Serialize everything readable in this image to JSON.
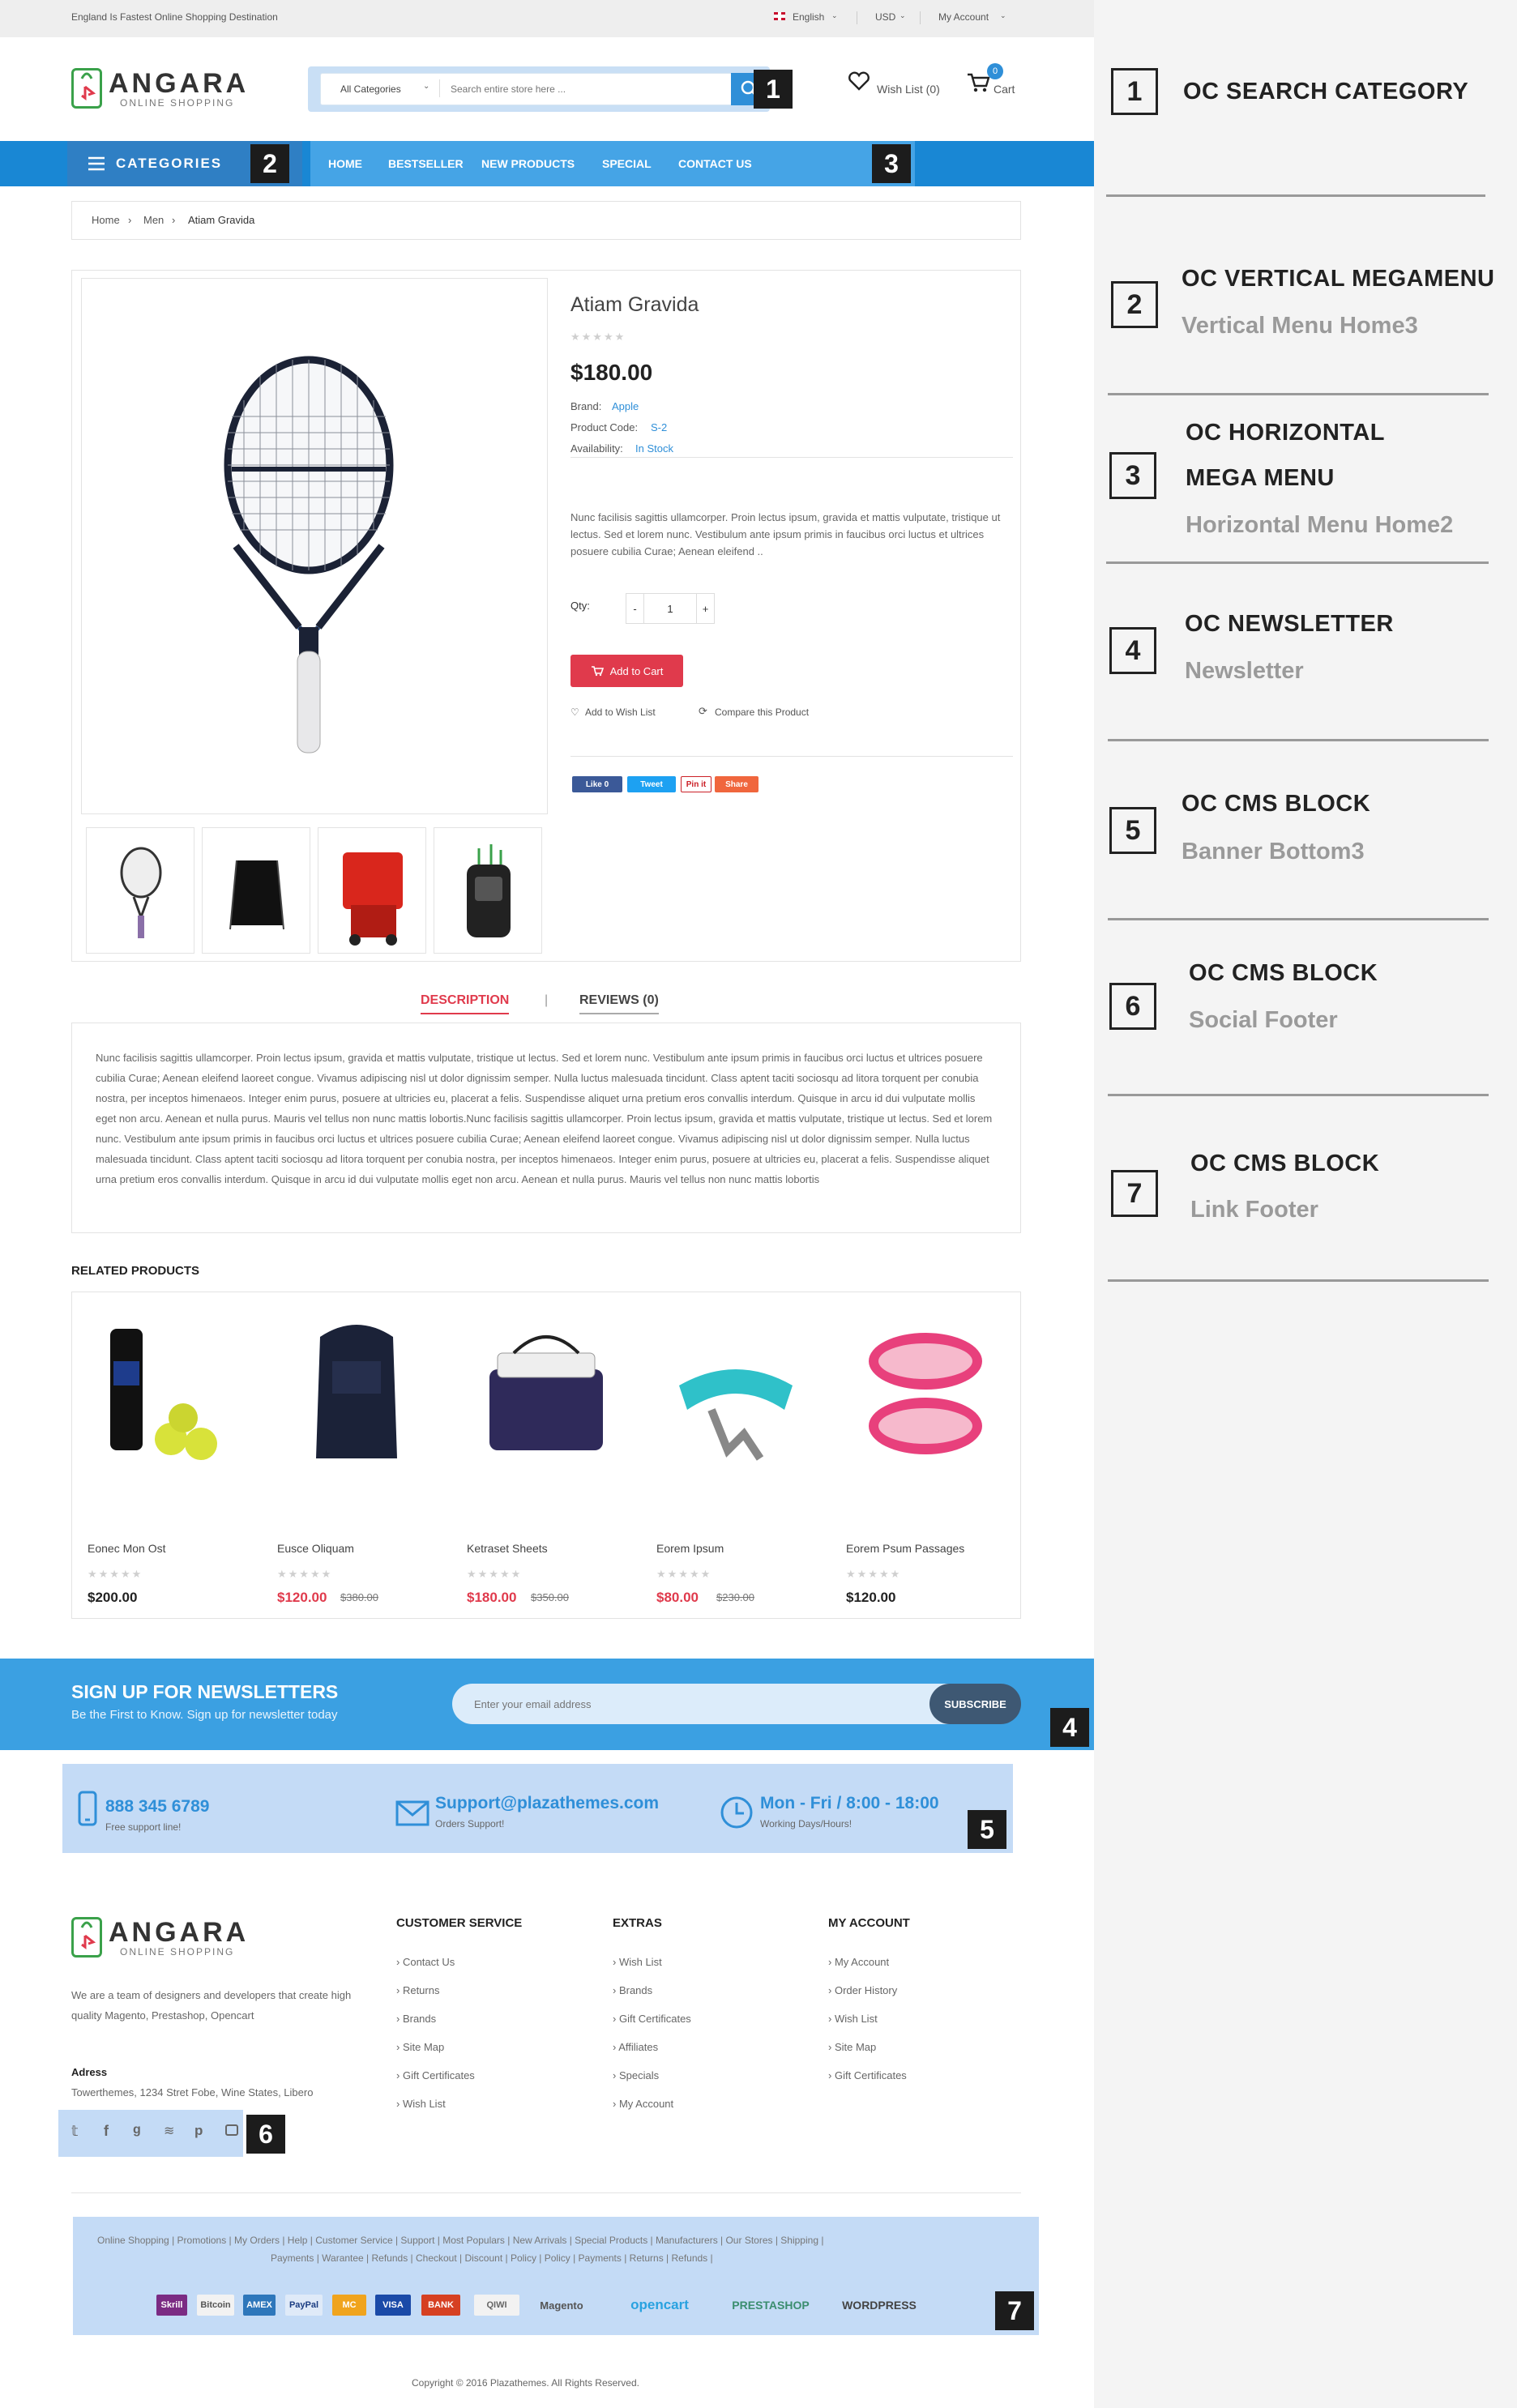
{
  "topbar": {
    "tagline": "England Is Fastest Online Shopping Destination",
    "language": "English",
    "currency": "USD",
    "account": "My Account"
  },
  "header": {
    "logo_title": "ANGARA",
    "logo_sub": "ONLINE SHOPPING",
    "search_category": "All Categories",
    "search_placeholder": "Search entire store here ...",
    "wishlist": "Wish List (0)",
    "cart_label": "Cart",
    "cart_count": "0"
  },
  "nav": {
    "categories": "CATEGORIES",
    "items": [
      "HOME",
      "BESTSELLER",
      "NEW PRODUCTS",
      "SPECIAL",
      "CONTACT US"
    ]
  },
  "breadcrumb": [
    "Home",
    "Men",
    "Atiam Gravida"
  ],
  "product": {
    "title": "Atiam Gravida",
    "price": "$180.00",
    "brand_label": "Brand:",
    "brand": "Apple",
    "code_label": "Product Code:",
    "code": "S-2",
    "availability_label": "Availability:",
    "availability": "In Stock",
    "short_desc": "Nunc facilisis sagittis ullamcorper. Proin lectus ipsum, gravida et mattis vulputate, tristique ut lectus. Sed et lorem nunc. Vestibulum ante ipsum primis in faucibus orci luctus et ultrices posuere cubilia Curae; Aenean eleifend ..",
    "qty_label": "Qty:",
    "qty": "1",
    "add_to_cart": "Add to Cart",
    "add_to_wishlist": "Add to Wish List",
    "compare": "Compare this Product",
    "share": [
      "Like 0",
      "Tweet",
      "Pin it",
      "Share"
    ]
  },
  "tabs": {
    "description": "DESCRIPTION",
    "reviews": "REVIEWS (0)",
    "body": "Nunc facilisis sagittis ullamcorper. Proin lectus ipsum, gravida et mattis vulputate, tristique ut lectus. Sed et lorem nunc. Vestibulum ante ipsum primis in faucibus orci luctus et ultrices posuere cubilia Curae; Aenean eleifend laoreet congue. Vivamus adipiscing nisl ut dolor dignissim semper. Nulla luctus malesuada tincidunt. Class aptent taciti sociosqu ad litora torquent per conubia nostra, per inceptos himenaeos. Integer enim purus, posuere at ultricies eu, placerat a felis. Suspendisse aliquet urna pretium eros convallis interdum. Quisque in arcu id dui vulputate mollis eget non arcu. Aenean et nulla purus. Mauris vel tellus non nunc mattis lobortis.Nunc facilisis sagittis ullamcorper. Proin lectus ipsum, gravida et mattis vulputate, tristique ut lectus. Sed et lorem nunc. Vestibulum ante ipsum primis in faucibus orci luctus et ultrices posuere cubilia Curae; Aenean eleifend laoreet congue. Vivamus adipiscing nisl ut dolor dignissim semper. Nulla luctus malesuada tincidunt. Class aptent taciti sociosqu ad litora torquent per conubia nostra, per inceptos himenaeos. Integer enim purus, posuere at ultricies eu, placerat a felis. Suspendisse aliquet urna pretium eros convallis interdum. Quisque in arcu id dui vulputate mollis eget non arcu. Aenean et nulla purus. Mauris vel tellus non nunc mattis lobortis"
  },
  "related": {
    "title": "RELATED PRODUCTS",
    "items": [
      {
        "name": "Eonec Mon Ost",
        "price": "$200.00",
        "old": ""
      },
      {
        "name": "Eusce Oliquam",
        "price": "$120.00",
        "old": "$380.00"
      },
      {
        "name": "Ketraset Sheets",
        "price": "$180.00",
        "old": "$350.00"
      },
      {
        "name": "Eorem Ipsum",
        "price": "$80.00",
        "old": "$230.00"
      },
      {
        "name": "Eorem Psum Passages",
        "price": "$120.00",
        "old": ""
      }
    ]
  },
  "newsletter": {
    "title": "SIGN UP FOR NEWSLETTERS",
    "subtitle": "Be the First to Know. Sign up for newsletter today",
    "placeholder": "Enter your email address",
    "button": "SUBSCRIBE"
  },
  "banner": {
    "phone": "888 345 6789",
    "phone_sub": "Free support line!",
    "email": "Support@plazathemes.com",
    "email_sub": "Orders Support!",
    "hours": "Mon - Fri / 8:00 - 18:00",
    "hours_sub": "Working Days/Hours!"
  },
  "footer": {
    "about": "We are a team of designers and developers that create high quality Magento, Prestashop, Opencart",
    "address_label": "Adress",
    "address": "Towerthemes, 1234 Stret Fobe, Wine States, Libero",
    "columns": [
      {
        "title": "CUSTOMER SERVICE",
        "links": [
          "Contact Us",
          "Returns",
          "Brands",
          "Site Map",
          "Gift Certificates",
          "Wish List"
        ]
      },
      {
        "title": "EXTRAS",
        "links": [
          "Wish List",
          "Brands",
          "Gift Certificates",
          "Affiliates",
          "Specials",
          "My Account"
        ]
      },
      {
        "title": "MY ACCOUNT",
        "links": [
          "My Account",
          "Order History",
          "Wish List",
          "Site Map",
          "Gift Certificates"
        ]
      }
    ],
    "links_line1": "Online Shopping | Promotions | My Orders | Help | Customer Service | Support | Most Populars | New Arrivals | Special Products | Manufacturers | Our Stores | Shipping |",
    "links_line2": "Payments | Warantee | Refunds | Checkout | Discount | Policy | Policy | Payments | Returns | Refunds |",
    "payments": [
      "Skrill",
      "Bitcoin",
      "AMEX",
      "PayPal",
      "MC",
      "VISA",
      "BANK",
      "QIWI",
      "Magento",
      "opencart",
      "PRESTASHOP",
      "WORDPRESS"
    ],
    "copyright": "Copyright © 2016 Plazathemes. All Rights Reserved."
  },
  "annotations": [
    {
      "num": "1",
      "title": "OC SEARCH CATEGORY",
      "title2": "",
      "sub": ""
    },
    {
      "num": "2",
      "title": "OC VERTICAL MEGAMENU",
      "title2": "",
      "sub": "Vertical Menu Home3"
    },
    {
      "num": "3",
      "title": "OC HORIZONTAL",
      "title2": "MEGA MENU",
      "sub": "Horizontal Menu Home2"
    },
    {
      "num": "4",
      "title": "OC NEWSLETTER",
      "title2": "",
      "sub": "Newsletter"
    },
    {
      "num": "5",
      "title": "OC CMS BLOCK",
      "title2": "",
      "sub": "Banner Bottom3"
    },
    {
      "num": "6",
      "title": "OC CMS BLOCK",
      "title2": "",
      "sub": "Social Footer"
    },
    {
      "num": "7",
      "title": "OC CMS BLOCK",
      "title2": "",
      "sub": "Link Footer"
    }
  ],
  "badges": [
    "1",
    "2",
    "3",
    "4",
    "5",
    "6",
    "7"
  ],
  "colors": {
    "primary": "#1987d4",
    "accent": "#e03a4c",
    "highlight": "#c4dbf6"
  }
}
